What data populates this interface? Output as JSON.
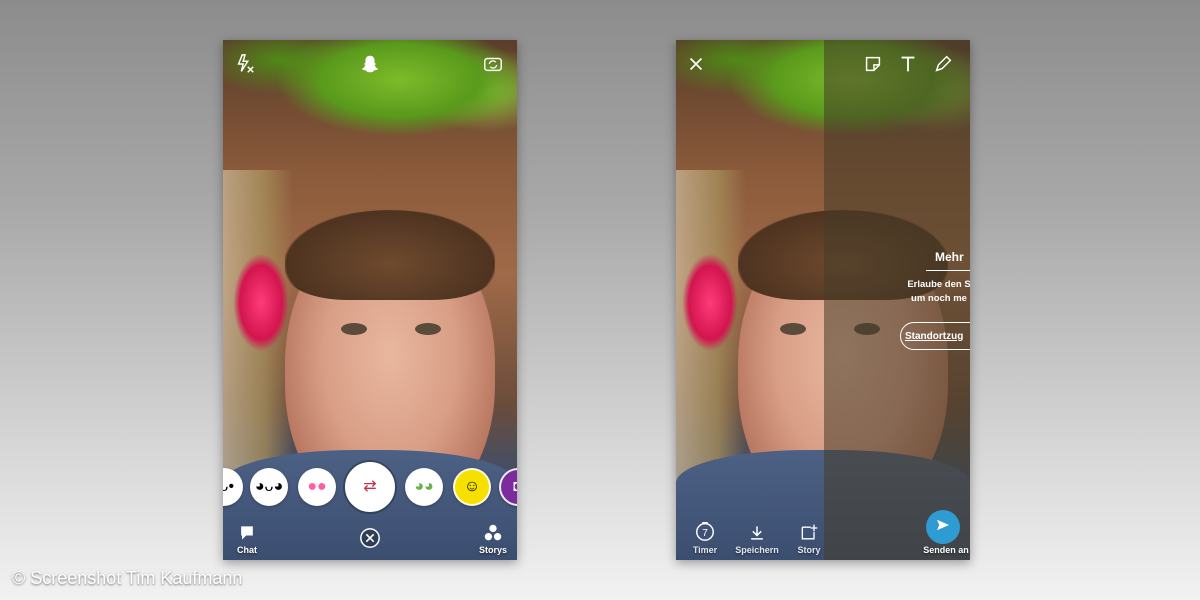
{
  "left_screen": {
    "top_icons": [
      "flash-off-icon",
      "ghost-icon",
      "camera-flip-icon"
    ],
    "lenses": [
      {
        "icon": "face-lens-icon"
      },
      {
        "icon": "face-lens-icon"
      },
      {
        "icon": "pink-faces-lens-icon"
      },
      {
        "icon": "face-swap-lens-icon",
        "selected": true
      },
      {
        "icon": "cartoon-faces-lens-icon"
      },
      {
        "icon": "yellow-faces-lens-icon"
      },
      {
        "icon": "camera-lens-icon"
      }
    ],
    "chat_label": "Chat",
    "stories_label": "Storys",
    "close_icon": "close-circle-icon"
  },
  "right_screen": {
    "top_icons": [
      "close-icon",
      "sticker-icon",
      "text-icon",
      "pencil-icon"
    ],
    "notice_title": "Mehr",
    "notice_line1": "Erlaube den S",
    "notice_line2": "um noch me",
    "notice_button": "Standortzug",
    "bottom_labels": {
      "timer": "Timer",
      "timer_value": "7",
      "save": "Speichern",
      "story": "Story",
      "send": "Senden an"
    },
    "colors": {
      "send_button": "#2f9bd3"
    }
  },
  "credit": "© Screenshot Tim Kaufmann"
}
